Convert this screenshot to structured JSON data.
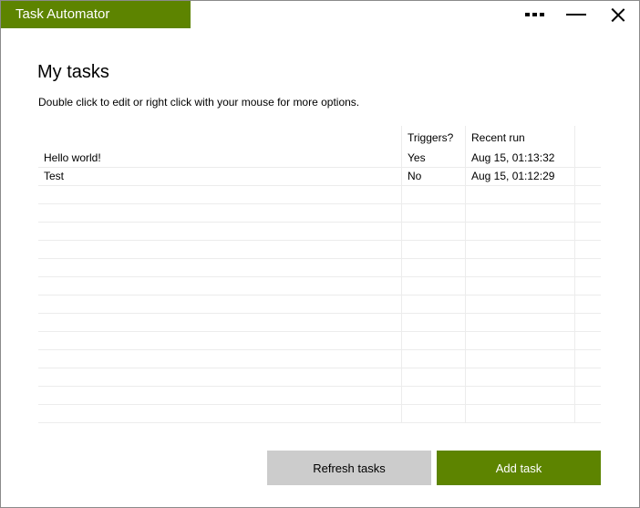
{
  "window": {
    "title": "Task Automator"
  },
  "accent_color": "#5d8400",
  "icons": {
    "more": "more-dots-icon",
    "minimize": "minimize-icon",
    "close": "close-icon"
  },
  "main": {
    "heading": "My tasks",
    "instructions": "Double click to edit or right click with your mouse for more options."
  },
  "table": {
    "columns": [
      "",
      "Triggers?",
      "Recent run"
    ],
    "rows": [
      {
        "name": "Hello world!",
        "triggers": "Yes",
        "recent_run": "Aug 15, 01:13:32"
      },
      {
        "name": "Test",
        "triggers": "No",
        "recent_run": "Aug 15, 01:12:29"
      }
    ]
  },
  "buttons": {
    "refresh": "Refresh tasks",
    "add": "Add task"
  }
}
